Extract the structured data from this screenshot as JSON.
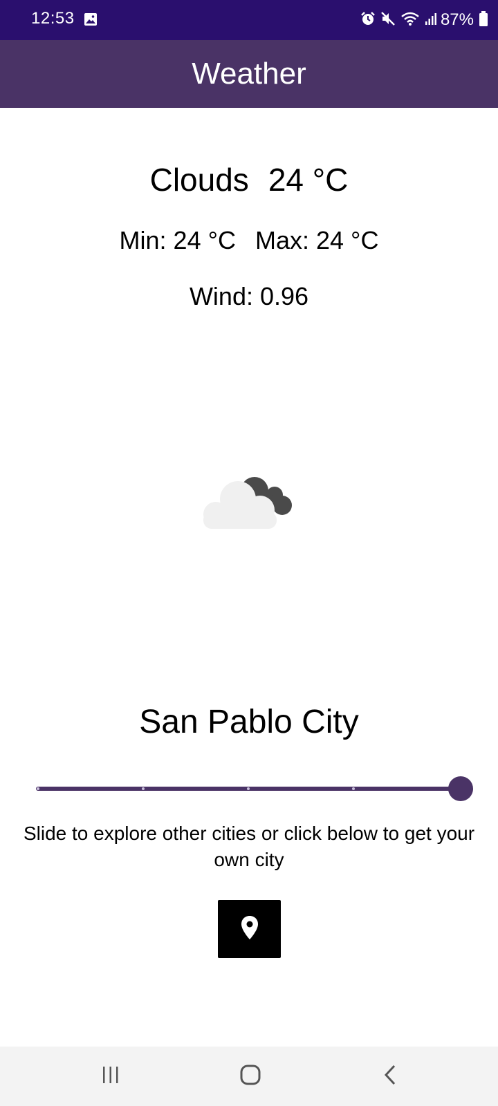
{
  "status_bar": {
    "time": "12:53",
    "battery_percent": "87%",
    "icons": [
      "gallery-icon",
      "alarm-icon",
      "mute-icon",
      "wifi-icon",
      "signal-icon",
      "battery-icon"
    ]
  },
  "app_bar": {
    "title": "Weather"
  },
  "weather": {
    "condition": "Clouds",
    "temperature": "24 °C",
    "min": "Min: 24 °C",
    "max": "Max: 24 °C",
    "wind": "Wind: 0.96",
    "icon": "clouds-icon"
  },
  "city": {
    "name": "San Pablo City"
  },
  "city_slider": {
    "value_fraction": 1.0,
    "steps": 5
  },
  "hint": {
    "text": "Slide to explore other cities or click below to get your own city"
  },
  "location_button": {
    "icon": "location-pin-icon"
  },
  "nav_bar": {
    "icons": [
      "recent-apps-icon",
      "home-icon",
      "back-icon"
    ]
  },
  "colors": {
    "status_bar": "#2a0f6e",
    "app_bar": "#4a3366",
    "accent": "#4a3366",
    "button": "#000000"
  }
}
